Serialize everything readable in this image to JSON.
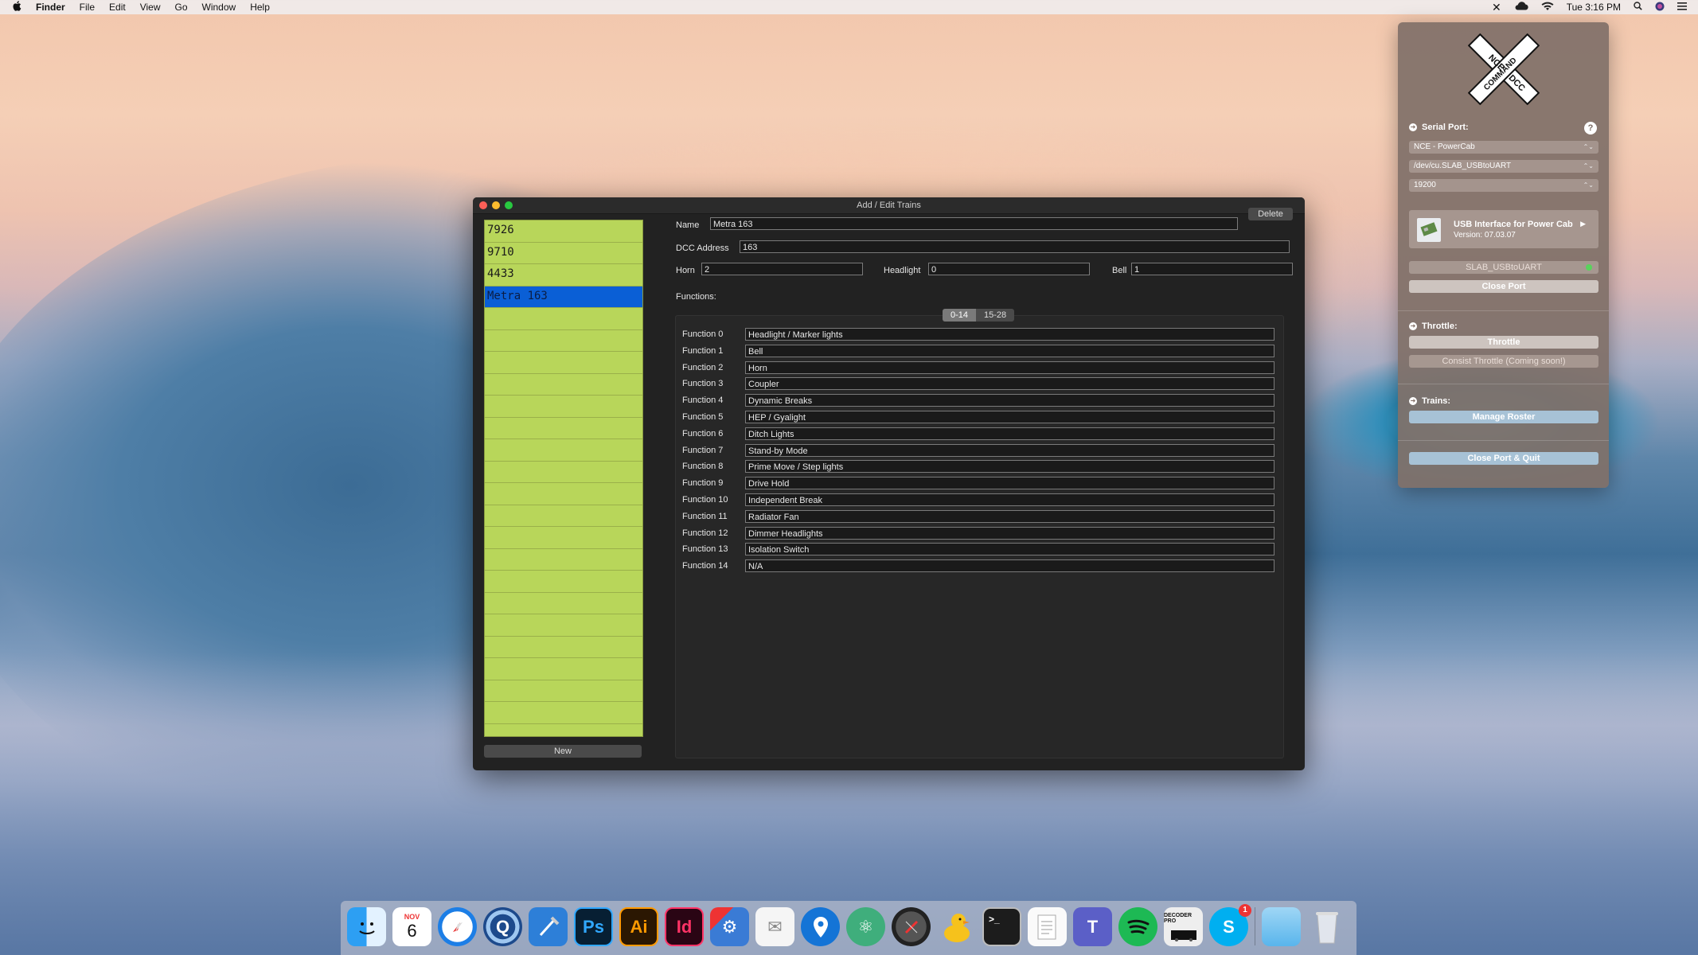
{
  "menubar": {
    "apple": "",
    "app": "Finder",
    "items": [
      "File",
      "Edit",
      "View",
      "Go",
      "Window",
      "Help"
    ],
    "clock": "Tue 3:16 PM"
  },
  "window": {
    "title": "Add / Edit Trains",
    "delete_label": "Delete",
    "new_label": "New",
    "roster": [
      "7926",
      "9710",
      "4433",
      "Metra 163"
    ],
    "selected_index": 3,
    "name_label": "Name",
    "name_value": "Metra 163",
    "dcc_label": "DCC Address",
    "dcc_value": "163",
    "horn_label": "Horn",
    "horn_value": "2",
    "headlight_label": "Headlight",
    "headlight_value": "0",
    "bell_label": "Bell",
    "bell_value": "1",
    "functions_label": "Functions:",
    "tabs": [
      "0-14",
      "15-28"
    ],
    "functions": [
      {
        "label": "Function 0",
        "value": "Headlight / Marker lights"
      },
      {
        "label": "Function 1",
        "value": "Bell"
      },
      {
        "label": "Function 2",
        "value": "Horn"
      },
      {
        "label": "Function 3",
        "value": "Coupler"
      },
      {
        "label": "Function 4",
        "value": "Dynamic Breaks"
      },
      {
        "label": "Function 5",
        "value": "HEP / Gyalight"
      },
      {
        "label": "Function 6",
        "value": "Ditch Lights"
      },
      {
        "label": "Function 7",
        "value": "Stand-by Mode"
      },
      {
        "label": "Function 8",
        "value": "Prime Move / Step lights"
      },
      {
        "label": "Function 9",
        "value": "Drive Hold"
      },
      {
        "label": "Function 10",
        "value": "Independent Break"
      },
      {
        "label": "Function 11",
        "value": "Radiator Fan"
      },
      {
        "label": "Function 12",
        "value": "Dimmer Headlights"
      },
      {
        "label": "Function 13",
        "value": "Isolation Switch"
      },
      {
        "label": "Function 14",
        "value": "N/A"
      }
    ]
  },
  "popover": {
    "logo_text": [
      "NCE",
      "COMMAND",
      "DCC"
    ],
    "serial_port_label": "Serial Port:",
    "help": "?",
    "system_select": "NCE - PowerCab",
    "port_select": "/dev/cu.SLAB_USBtoUART",
    "baud_select": "19200",
    "device_title": "USB Interface for Power Cab",
    "device_version": "Version: 07.03.07",
    "port_status": "SLAB_USBtoUART",
    "close_port": "Close Port",
    "throttle_label": "Throttle:",
    "throttle_btn": "Throttle",
    "consist_btn": "Consist Throttle (Coming soon!)",
    "trains_label": "Trains:",
    "manage_btn": "Manage Roster",
    "quit_btn": "Close Port & Quit"
  },
  "dock": {
    "calendar_month": "NOV",
    "calendar_day": "6",
    "ps": "Ps",
    "ai": "Ai",
    "id": "Id",
    "decoder": "DECODER PRO",
    "skype_badge": "1"
  },
  "colors": {
    "roster_bg": "#b8d65a",
    "selection": "#0a5fd6",
    "window_bg": "#222222",
    "popover_bg": "#807068"
  }
}
